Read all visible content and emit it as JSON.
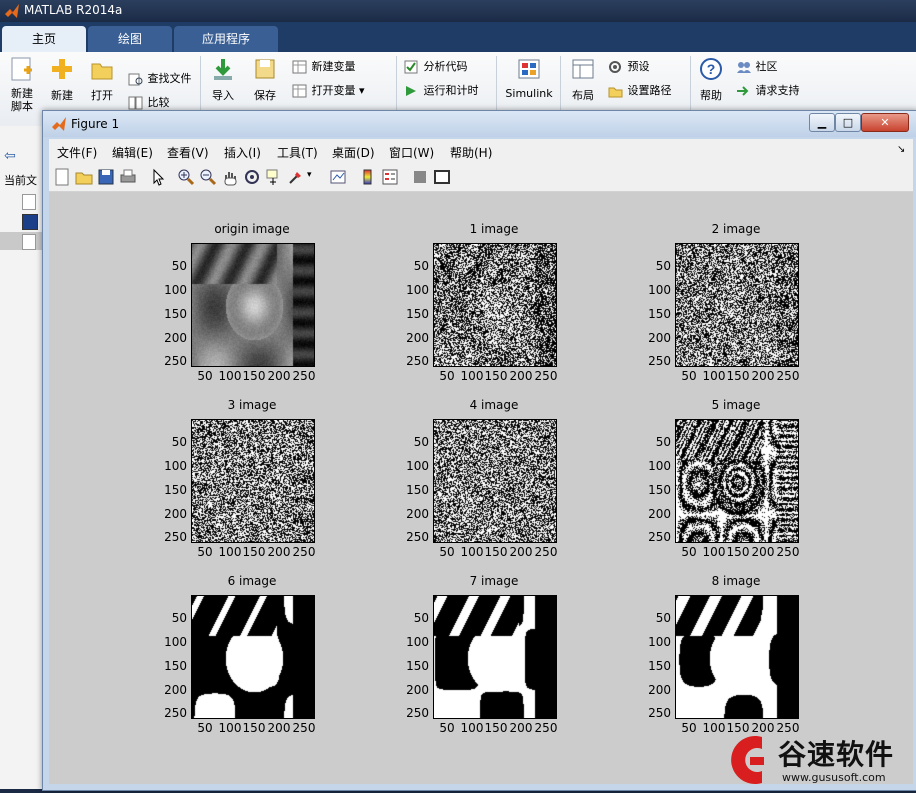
{
  "matlab": {
    "title": "MATLAB R2014a",
    "tabs": [
      "主页",
      "绘图",
      "应用程序"
    ],
    "ribbon": {
      "new_script": "新建\n脚本",
      "new": "新建",
      "open": "打开",
      "find_files": "查找文件",
      "compare": "比较",
      "import": "导入",
      "save": "保存",
      "new_variable": "新建变量",
      "open_variable": "打开变量",
      "analyze_code": "分析代码",
      "run_and_time": "运行和计时",
      "simulink": "Simulink",
      "layout": "布局",
      "preferences": "预设",
      "set_path": "设置路径",
      "help": "帮助",
      "community": "社区",
      "request_support": "请求支持"
    },
    "left_panel_label": "当前文"
  },
  "figure": {
    "title": "Figure 1",
    "menu": [
      "文件(F)",
      "编辑(E)",
      "查看(V)",
      "插入(I)",
      "工具(T)",
      "桌面(D)",
      "窗口(W)",
      "帮助(H)"
    ],
    "subplots": [
      {
        "title": "origin image"
      },
      {
        "title": "1 image"
      },
      {
        "title": "2 image"
      },
      {
        "title": "3 image"
      },
      {
        "title": "4 image"
      },
      {
        "title": "5 image"
      },
      {
        "title": "6 image"
      },
      {
        "title": "7 image"
      },
      {
        "title": "8 image"
      }
    ],
    "yticks": [
      "50",
      "100",
      "150",
      "200",
      "250"
    ],
    "xticks": [
      "50",
      "100",
      "150",
      "200",
      "250"
    ]
  },
  "watermark": {
    "brand": "谷速软件",
    "url": "www.gususoft.com"
  }
}
